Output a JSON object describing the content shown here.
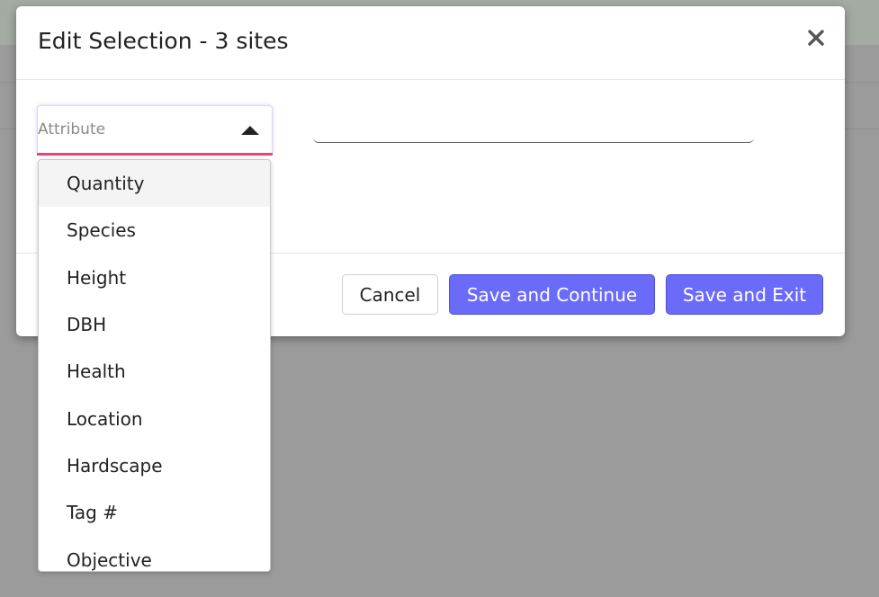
{
  "modal": {
    "title": "Edit Selection - 3 sites",
    "close_icon": "close-icon"
  },
  "attribute_select": {
    "placeholder": "Attribute",
    "state": "open"
  },
  "value_input": {
    "value": ""
  },
  "dropdown": {
    "options": [
      "Quantity",
      "Species",
      "Height",
      "DBH",
      "Health",
      "Location",
      "Hardscape",
      "Tag #",
      "Objective"
    ],
    "highlighted_index": 0
  },
  "footer": {
    "cancel_label": "Cancel",
    "save_continue_label": "Save and Continue",
    "save_exit_label": "Save and Exit"
  },
  "colors": {
    "primary": "#6b6bfa",
    "focus_underline": "#e8437e",
    "overlay": "#9b9b9b"
  }
}
